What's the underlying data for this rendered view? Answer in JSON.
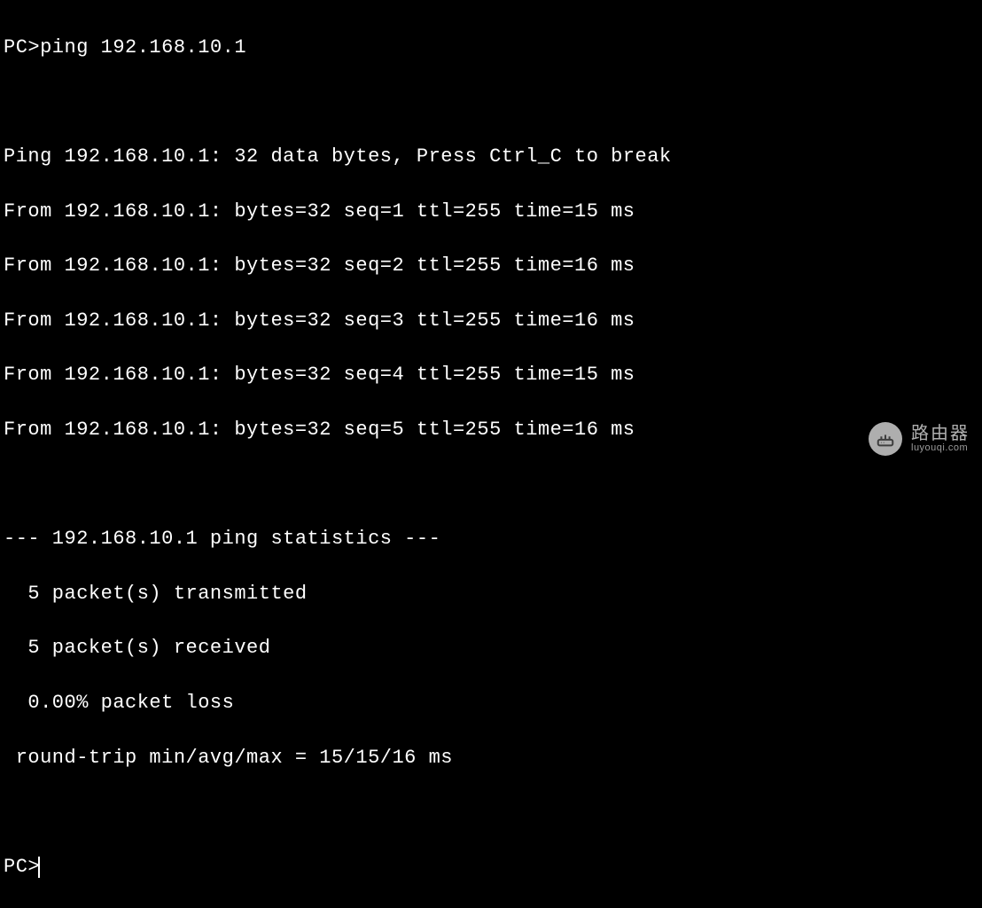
{
  "terminal": {
    "prompt1": "PC>",
    "command1": "ping 192.168.10.1",
    "blank1": "",
    "header": "Ping 192.168.10.1: 32 data bytes, Press Ctrl_C to break",
    "reply1": "From 192.168.10.1: bytes=32 seq=1 ttl=255 time=15 ms",
    "reply2": "From 192.168.10.1: bytes=32 seq=2 ttl=255 time=16 ms",
    "reply3": "From 192.168.10.1: bytes=32 seq=3 ttl=255 time=16 ms",
    "reply4": "From 192.168.10.1: bytes=32 seq=4 ttl=255 time=15 ms",
    "reply5": "From 192.168.10.1: bytes=32 seq=5 ttl=255 time=16 ms",
    "blank2": "",
    "statsHeader": "--- 192.168.10.1 ping statistics ---",
    "statsTx": "  5 packet(s) transmitted",
    "statsRx": "  5 packet(s) received",
    "statsLoss": "  0.00% packet loss",
    "statsRtt": " round-trip min/avg/max = 15/15/16 ms",
    "blank3": "",
    "prompt2": "PC>"
  },
  "watermark": {
    "title": "路由器",
    "sub": "luyouqi.com"
  }
}
